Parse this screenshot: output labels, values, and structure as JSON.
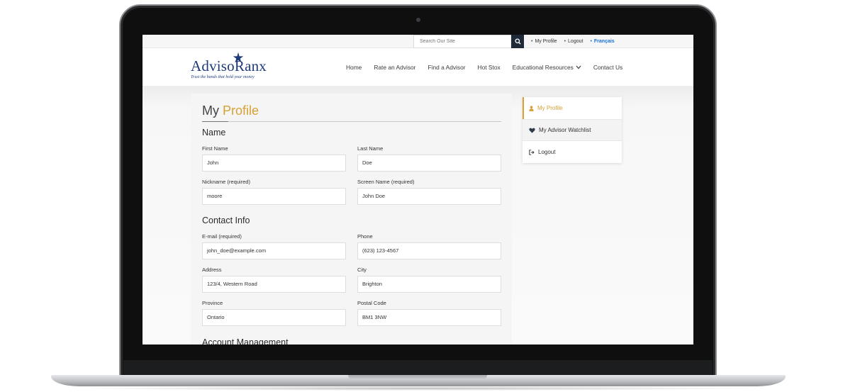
{
  "topbar": {
    "search_placeholder": "Search Our Site",
    "links": [
      {
        "label": "My Profile"
      },
      {
        "label": "Logout"
      },
      {
        "label": "Français"
      }
    ]
  },
  "header": {
    "logo_text": "AdvisoRanx",
    "logo_tagline": "Trust the hands that hold your money",
    "nav": [
      {
        "label": "Home"
      },
      {
        "label": "Rate an Advisor"
      },
      {
        "label": "Find a Advisor"
      },
      {
        "label": "Hot Stox"
      },
      {
        "label": "Educational Resources"
      },
      {
        "label": "Contact Us"
      }
    ]
  },
  "profile": {
    "title_part1": "My",
    "title_part2": "Profile",
    "sections": {
      "name": "Name",
      "contact": "Contact Info",
      "account": "Account Management"
    },
    "fields": {
      "first_name": {
        "label": "First Name",
        "value": "John"
      },
      "last_name": {
        "label": "Last Name",
        "value": "Doe"
      },
      "nickname": {
        "label": "Nickname (required)",
        "value": "moore"
      },
      "screen_name": {
        "label": "Screen Name (required)",
        "value": "John Doe"
      },
      "email": {
        "label": "E-mail (required)",
        "value": "john_doe@example.com"
      },
      "phone": {
        "label": "Phone",
        "value": "(623) 123-4567"
      },
      "address": {
        "label": "Address",
        "value": "123/4, Western Road"
      },
      "city": {
        "label": "City",
        "value": "Brighton"
      },
      "province": {
        "label": "Province",
        "value": "Ontario"
      },
      "postal_code": {
        "label": "Postal Code",
        "value": "BM1 3NW"
      }
    }
  },
  "sidebar": {
    "items": [
      {
        "label": "My Profile",
        "icon": "user-icon"
      },
      {
        "label": "My Advisor Watchlist",
        "icon": "heart-icon"
      },
      {
        "label": "Logout",
        "icon": "sign-out-icon"
      }
    ]
  },
  "colors": {
    "accent": "#d8a034",
    "brand": "#1d3a7a",
    "search_button": "#1e2a3a",
    "language_link": "#1a6fd1"
  }
}
